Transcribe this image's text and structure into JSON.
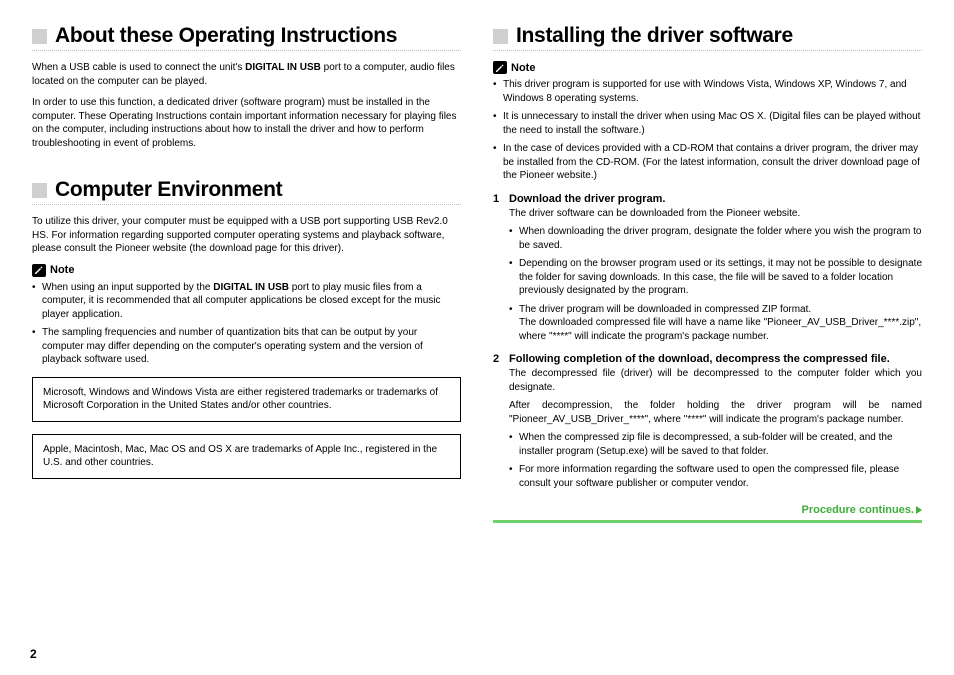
{
  "page_number": "2",
  "left": {
    "s1": {
      "title": "About these Operating Instructions",
      "p1a": "When a USB cable is used to connect the unit's ",
      "p1b": "DIGITAL IN USB",
      "p1c": " port to a computer, audio files located on the computer can be played.",
      "p2": "In order to use this function, a dedicated driver (software program) must be installed in the computer. These Operating Instructions contain important information necessary for playing files on the computer, including instructions about how to install the driver and how to perform troubleshooting in event of problems."
    },
    "s2": {
      "title": "Computer Environment",
      "p1": "To utilize this driver, your computer must be equipped with a USB port supporting USB Rev2.0 HS. For information regarding supported computer operating systems and playback software, please consult the Pioneer website (the download page for this driver).",
      "note_label": "Note",
      "n1a": "When using an input supported by the ",
      "n1b": "DIGITAL IN USB",
      "n1c": " port to play music files from a computer, it is recommended that all computer applications be closed except for the music player application.",
      "n2": "The sampling frequencies and number of quantization bits that can be output by your computer may differ depending on the computer's operating system and the version of playback software used.",
      "tm1": "Microsoft, Windows and Windows Vista are either registered trademarks or trademarks of Microsoft Corporation in the United States and/or other countries.",
      "tm2": "Apple, Macintosh, Mac, Mac OS and OS X are trademarks of Apple Inc., registered in the U.S. and other countries."
    }
  },
  "right": {
    "title": "Installing the driver software",
    "note_label": "Note",
    "n1": "This driver program is supported for use with Windows Vista, Windows XP, Windows 7, and Windows 8 operating systems.",
    "n2": "It is unnecessary to install the driver when using Mac OS X. (Digital files can be played without the need to install the software.)",
    "n3": "In the case of devices provided with a CD-ROM that contains a driver program, the driver may be installed from the CD-ROM. (For the latest information, consult the driver download page of the Pioneer website.)",
    "step1": {
      "title": "Download the driver program.",
      "desc": "The driver software can be downloaded from the Pioneer website.",
      "b1": "When downloading the driver program, designate the folder where you wish the program to be saved.",
      "b2": "Depending on the browser program used or its settings, it may not be possible to designate the folder for saving downloads. In this case, the file will be saved to a folder location previously designated by the program.",
      "b3": "The driver program will be downloaded in compressed ZIP format.",
      "b3x": "The downloaded compressed file will have a name like \"Pioneer_AV_USB_Driver_****.zip\", where \"****\" will indicate the program's package number."
    },
    "step2": {
      "title": "Following completion of the download, decompress the compressed file.",
      "d1": "The decompressed file (driver) will be decompressed to the computer folder which you designate.",
      "d2": "After decompression, the folder holding the driver program will be named \"Pioneer_AV_USB_Driver_****\", where \"****\" will indicate the program's package number.",
      "b1": "When the compressed zip file is decompressed, a sub-folder will be created, and the installer program (Setup.exe) will be saved to that folder.",
      "b2": "For more information regarding the software used to open the compressed file, please consult your software publisher or computer vendor."
    },
    "continues": "Procedure continues."
  }
}
